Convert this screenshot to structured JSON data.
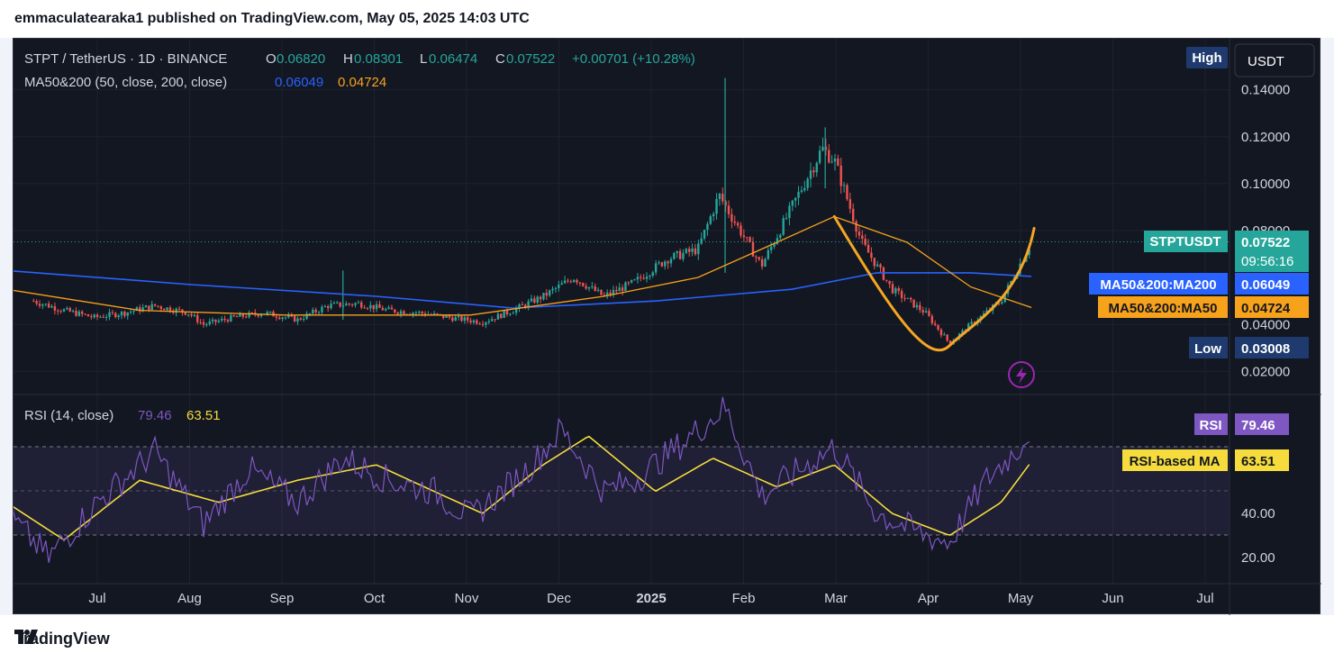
{
  "publisher_line": "emmaculatearaka1 published on TradingView.com, May 05, 2025 14:03 UTC",
  "brand": "TradingView",
  "header": {
    "symbol_line": "STPT / TetherUS · 1D · BINANCE",
    "o_label": "O",
    "o_value": "0.06820",
    "h_label": "H",
    "h_value": "0.08301",
    "l_label": "L",
    "l_value": "0.06474",
    "c_label": "C",
    "c_value": "0.07522",
    "change": "+0.00701 (+10.28%)",
    "ma_label": "MA50&200 (50, close, 200, close)",
    "ma200_value": "0.06049",
    "ma50_value": "0.04724",
    "rsi_label": "RSI (14, close)",
    "rsi_value": "79.46",
    "rsi_ma_value": "63.51"
  },
  "buttons": {
    "high": "High",
    "currency": "USDT"
  },
  "price_axis": {
    "ticks": [
      "0.14000",
      "0.12000",
      "0.10000",
      "0.08000",
      "0.04000",
      "0.02000"
    ],
    "tick_values": [
      0.14,
      0.12,
      0.1,
      0.08,
      0.04,
      0.02
    ]
  },
  "rsi_axis": {
    "ticks": [
      "40.00",
      "20.00"
    ],
    "tick_values": [
      40,
      20
    ]
  },
  "badges": {
    "symbol": "STPTUSDT",
    "price": "0.07522",
    "countdown": "09:56:16",
    "ma200_label": "MA50&200:MA200",
    "ma200_value": "0.06049",
    "ma50_label": "MA50&200:MA50",
    "ma50_value": "0.04724",
    "low_label": "Low",
    "low_value": "0.03008",
    "rsi_label": "RSI",
    "rsi_value": "79.46",
    "rsima_label": "RSI-based MA",
    "rsima_value": "63.51"
  },
  "colors": {
    "bg": "#131722",
    "up": "#26a69a",
    "down": "#ef5350",
    "ma200": "#2962ff",
    "ma50": "#f7a21b",
    "rsi": "#7e57c2",
    "rsi_ma": "#f5dc3c",
    "curve": "#f5a623",
    "grid": "#1e222d",
    "text": "#d1d4dc",
    "lightning": "#9c27b0"
  },
  "chart_data": [
    {
      "type": "candlestick",
      "title": "STPT / TetherUS · 1D · BINANCE",
      "time_axis": [
        "Jul",
        "Aug",
        "Sep",
        "Oct",
        "Nov",
        "Dec",
        "2025",
        "Feb",
        "Mar",
        "Apr",
        "May",
        "Jun",
        "Jul"
      ],
      "ylim": [
        0.02,
        0.14
      ],
      "close_path": [
        [
          "2024-06-10",
          0.05
        ],
        [
          "2024-06-20",
          0.046
        ],
        [
          "2024-06-30",
          0.043
        ],
        [
          "2024-07-10",
          0.045
        ],
        [
          "2024-07-20",
          0.048
        ],
        [
          "2024-07-31",
          0.045
        ],
        [
          "2024-08-05",
          0.04
        ],
        [
          "2024-08-15",
          0.043
        ],
        [
          "2024-08-25",
          0.045
        ],
        [
          "2024-09-05",
          0.042
        ],
        [
          "2024-09-15",
          0.048
        ],
        [
          "2024-09-25",
          0.049
        ],
        [
          "2024-10-05",
          0.046
        ],
        [
          "2024-10-15",
          0.045
        ],
        [
          "2024-10-25",
          0.043
        ],
        [
          "2024-11-05",
          0.041
        ],
        [
          "2024-11-15",
          0.046
        ],
        [
          "2024-11-25",
          0.052
        ],
        [
          "2024-12-05",
          0.06
        ],
        [
          "2024-12-15",
          0.052
        ],
        [
          "2024-12-25",
          0.058
        ],
        [
          "2025-01-05",
          0.068
        ],
        [
          "2025-01-15",
          0.072
        ],
        [
          "2025-01-22",
          0.095
        ],
        [
          "2025-01-28",
          0.082
        ],
        [
          "2025-02-05",
          0.065
        ],
        [
          "2025-02-15",
          0.09
        ],
        [
          "2025-02-25",
          0.115
        ],
        [
          "2025-03-01",
          0.11
        ],
        [
          "2025-03-10",
          0.075
        ],
        [
          "2025-03-20",
          0.055
        ],
        [
          "2025-03-31",
          0.045
        ],
        [
          "2025-04-08",
          0.032
        ],
        [
          "2025-04-15",
          0.04
        ],
        [
          "2025-04-25",
          0.05
        ],
        [
          "2025-05-05",
          0.07522
        ]
      ],
      "spikes": [
        {
          "date": "2025-01-24",
          "high": 0.145,
          "low": 0.062
        },
        {
          "date": "2025-02-26",
          "high": 0.124,
          "low": 0.098
        },
        {
          "date": "2024-09-20",
          "high": 0.063,
          "low": 0.042
        }
      ],
      "series": [
        {
          "name": "MA50&200:MA200",
          "points": [
            [
              "2024-06-01",
              0.063
            ],
            [
              "2024-08-01",
              0.057
            ],
            [
              "2024-10-01",
              0.052
            ],
            [
              "2024-11-15",
              0.047
            ],
            [
              "2025-01-01",
              0.05
            ],
            [
              "2025-02-15",
              0.055
            ],
            [
              "2025-03-15",
              0.062
            ],
            [
              "2025-04-15",
              0.062
            ],
            [
              "2025-05-05",
              0.06049
            ]
          ]
        },
        {
          "name": "MA50&200:MA50",
          "points": [
            [
              "2024-06-01",
              0.055
            ],
            [
              "2024-07-15",
              0.046
            ],
            [
              "2024-09-01",
              0.044
            ],
            [
              "2024-11-01",
              0.044
            ],
            [
              "2024-12-15",
              0.052
            ],
            [
              "2025-01-15",
              0.06
            ],
            [
              "2025-02-10",
              0.075
            ],
            [
              "2025-03-01",
              0.086
            ],
            [
              "2025-03-25",
              0.075
            ],
            [
              "2025-04-15",
              0.056
            ],
            [
              "2025-05-05",
              0.04724
            ]
          ]
        }
      ],
      "last_price": 0.07522,
      "low": 0.03008
    },
    {
      "type": "line",
      "title": "RSI (14, close)",
      "ylim": [
        10,
        90
      ],
      "bands": [
        30,
        50,
        70
      ],
      "series": [
        {
          "name": "RSI",
          "points": [
            [
              "2024-06-01",
              40
            ],
            [
              "2024-06-15",
              20
            ],
            [
              "2024-07-01",
              45
            ],
            [
              "2024-07-20",
              68
            ],
            [
              "2024-08-05",
              35
            ],
            [
              "2024-08-20",
              60
            ],
            [
              "2024-09-05",
              45
            ],
            [
              "2024-09-20",
              65
            ],
            [
              "2024-10-05",
              55
            ],
            [
              "2024-10-20",
              50
            ],
            [
              "2024-11-01",
              38
            ],
            [
              "2024-11-20",
              60
            ],
            [
              "2024-12-01",
              78
            ],
            [
              "2024-12-15",
              50
            ],
            [
              "2024-12-25",
              55
            ],
            [
              "2025-01-10",
              72
            ],
            [
              "2025-01-24",
              88
            ],
            [
              "2025-02-05",
              48
            ],
            [
              "2025-02-20",
              62
            ],
            [
              "2025-03-01",
              70
            ],
            [
              "2025-03-15",
              40
            ],
            [
              "2025-03-31",
              30
            ],
            [
              "2025-04-08",
              27
            ],
            [
              "2025-04-20",
              55
            ],
            [
              "2025-05-01",
              70
            ],
            [
              "2025-05-05",
              79.46
            ]
          ]
        },
        {
          "name": "RSI-based MA",
          "points": [
            [
              "2024-06-01",
              45
            ],
            [
              "2024-06-20",
              28
            ],
            [
              "2024-07-15",
              55
            ],
            [
              "2024-08-10",
              45
            ],
            [
              "2024-09-05",
              55
            ],
            [
              "2024-10-01",
              62
            ],
            [
              "2024-10-20",
              50
            ],
            [
              "2024-11-05",
              40
            ],
            [
              "2024-11-25",
              62
            ],
            [
              "2024-12-10",
              75
            ],
            [
              "2025-01-01",
              50
            ],
            [
              "2025-01-20",
              65
            ],
            [
              "2025-02-10",
              52
            ],
            [
              "2025-03-01",
              62
            ],
            [
              "2025-03-20",
              40
            ],
            [
              "2025-04-08",
              30
            ],
            [
              "2025-04-25",
              45
            ],
            [
              "2025-05-05",
              63.51
            ]
          ]
        }
      ]
    }
  ]
}
